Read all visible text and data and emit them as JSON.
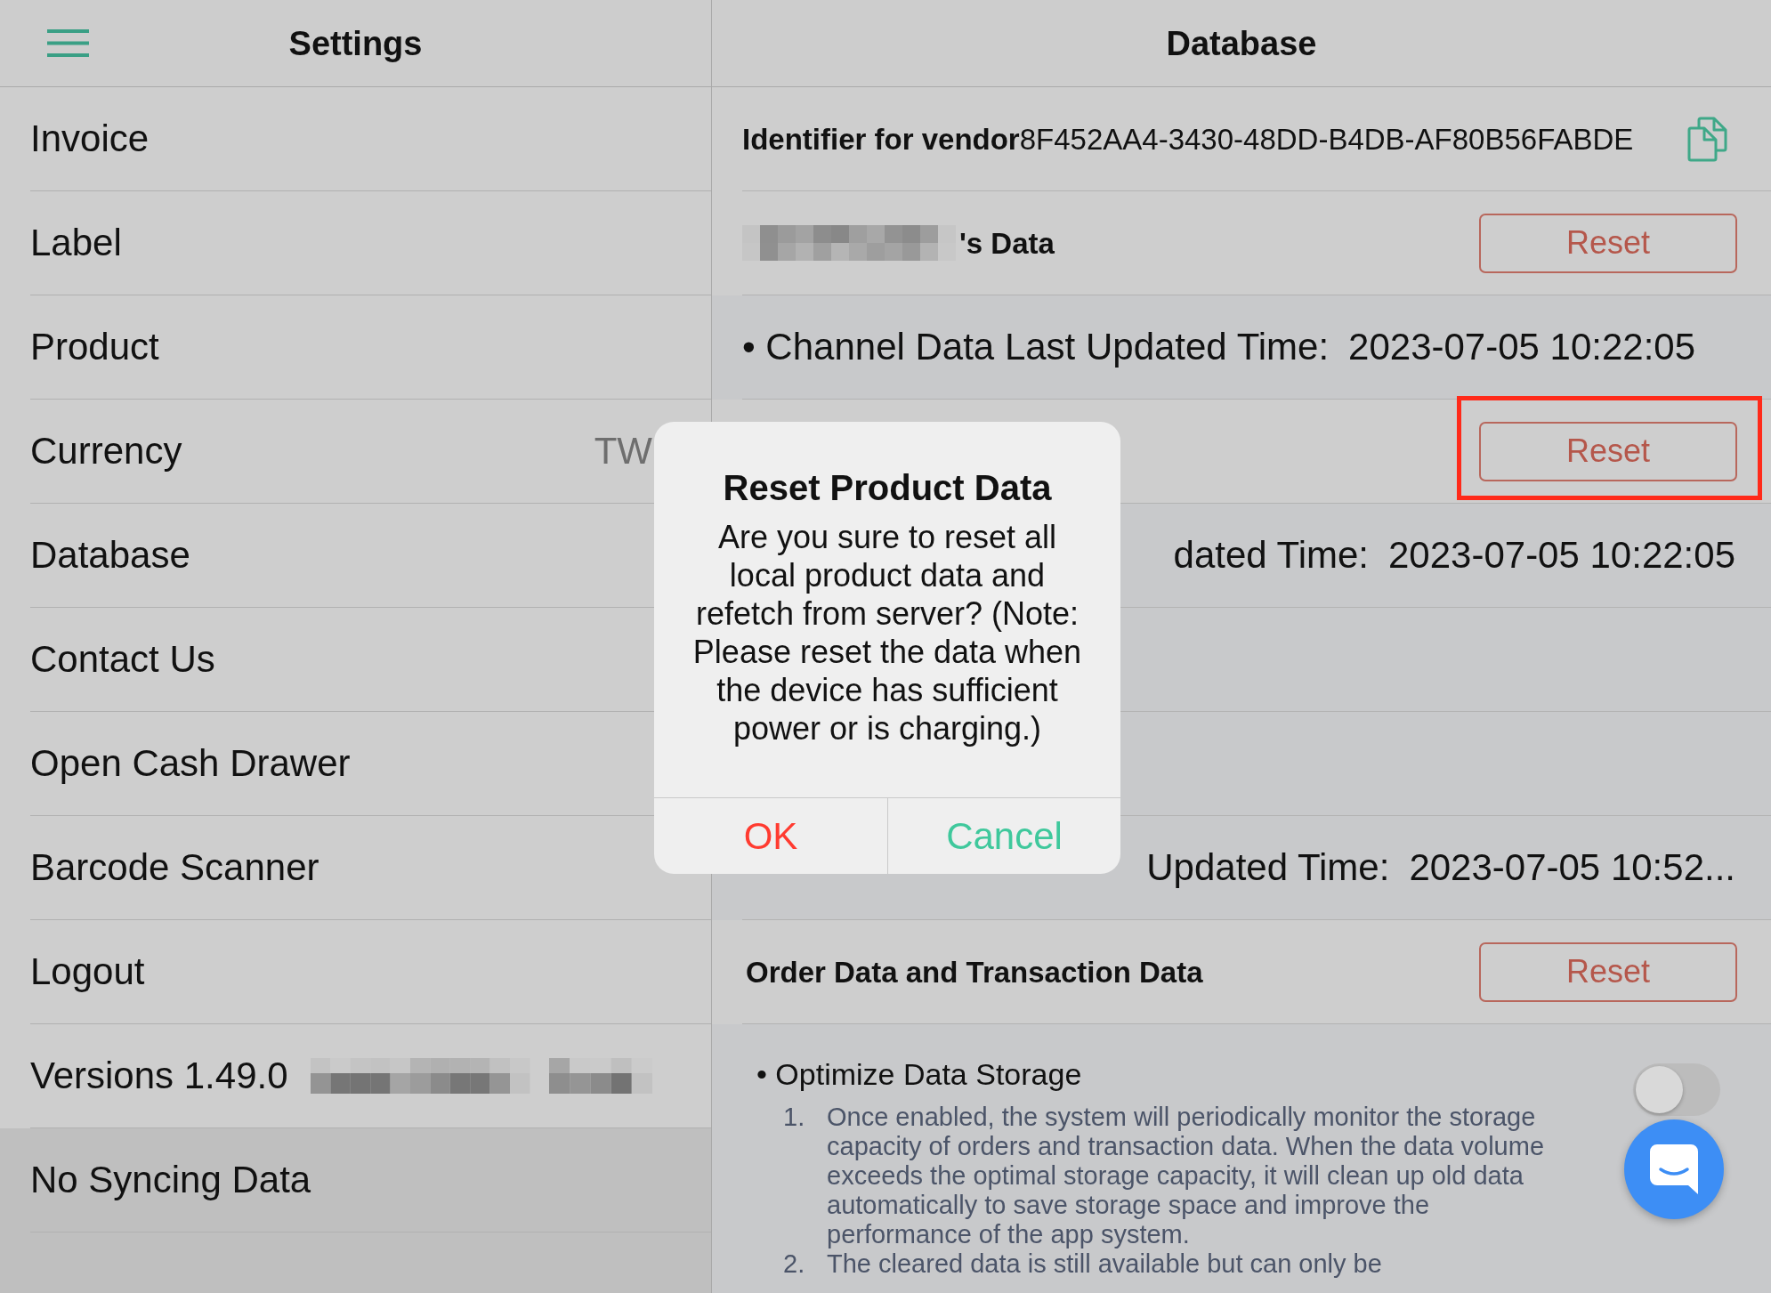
{
  "sidebar": {
    "title": "Settings",
    "items": [
      {
        "label": "Invoice",
        "kind": "link"
      },
      {
        "label": "Label",
        "kind": "link"
      },
      {
        "label": "Product",
        "kind": "link"
      },
      {
        "label": "Currency",
        "value": "TW",
        "kind": "link"
      },
      {
        "label": "Database",
        "kind": "link"
      },
      {
        "label": "Contact Us",
        "kind": "link"
      },
      {
        "label": "Open Cash Drawer",
        "kind": "link"
      },
      {
        "label": "Barcode Scanner",
        "kind": "link"
      },
      {
        "label": "Logout",
        "kind": "link"
      },
      {
        "label": "Versions 1.49.0",
        "kind": "version",
        "pixelated": true
      },
      {
        "label": "No Syncing Data",
        "kind": "status"
      }
    ]
  },
  "detail": {
    "title": "Database",
    "rows": [
      {
        "kind": "identifier",
        "label": "Identifier for vendor",
        "value": "8F452AA4-3430-48DD-B4DB-AF80B56FABDE"
      },
      {
        "kind": "section",
        "label": "'s Data",
        "name_pixelated": true,
        "button": "Reset",
        "highlighted": false
      },
      {
        "kind": "timestamp",
        "label": "• Channel Data Last Updated Time:",
        "value": "2023-07-05 10:22:05"
      },
      {
        "kind": "section",
        "button": "Reset",
        "highlighted": true
      },
      {
        "kind": "covered_timestamp",
        "label": "dated Time:",
        "value": "2023-07-05 10:22:05"
      },
      {
        "kind": "blank"
      },
      {
        "kind": "blank"
      },
      {
        "kind": "covered_timestamp",
        "label": "Updated Time:",
        "value": "2023-07-05 10:52..."
      },
      {
        "kind": "section",
        "label": "Order Data and Transaction Data",
        "button": "Reset",
        "highlighted": false
      }
    ]
  },
  "optimize": {
    "label": "• Optimize Data Storage",
    "on": false,
    "notes": [
      {
        "number": "1.",
        "text": "Once enabled, the system will periodically monitor the storage capacity of orders and transaction data. When the data volume exceeds the optimal storage capacity, it will clean up old data automatically to save storage space and improve the performance of the app system."
      },
      {
        "number": "2.",
        "text": "The cleared data is still available but can only be"
      }
    ]
  },
  "dialog": {
    "title": "Reset Product Data",
    "message": "Are you sure to reset all local product data and refetch from server? (Note: Please reset the data when the device has sufficient power or is charging.)",
    "buttons": [
      {
        "label": "OK",
        "kind": "destructive"
      },
      {
        "label": "Cancel",
        "kind": "cancel"
      }
    ]
  }
}
